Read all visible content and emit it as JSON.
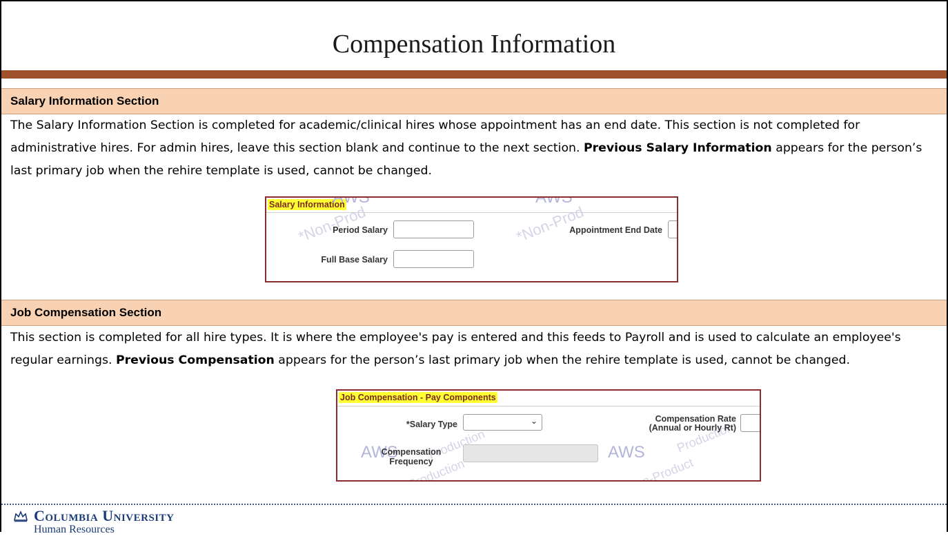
{
  "slide": {
    "title": "Compensation Information"
  },
  "salary_section": {
    "header": "Salary Information Section",
    "para_part1": "The Salary Information Section is completed for academic/clinical hires whose appointment has an end date. This section is not completed for administrative hires. For admin hires, leave this section blank and continue to the next section. ",
    "para_bold": "Previous Salary Information",
    "para_part2": " appears for the person’s last primary job when the rehire template is used, cannot be changed.",
    "panel": {
      "title": "Salary Information",
      "period_salary_label": "Period Salary",
      "appointment_end_date_label": "Appointment End Date",
      "full_base_salary_label": "Full Base Salary",
      "watermark_1": "*Non-Prod",
      "watermark_2": "*Non-Prod",
      "watermark_3": "AWS",
      "watermark_4": "AWS"
    }
  },
  "job_comp_section": {
    "header": "Job Compensation Section",
    "para_part1": "This section is completed for all hire types. It is where the employee's pay is entered and this feeds to Payroll and is used to calculate an employee's regular earnings. ",
    "para_bold": "Previous Compensation",
    "para_part2": " appears for the person’s last primary job when the rehire template is used, cannot be changed.",
    "panel": {
      "title": "Job Compensation - Pay Components",
      "salary_type_label": "*Salary Type",
      "salary_type_value": "",
      "compensation_rate_label_line1": "Compensation Rate",
      "compensation_rate_label_line2": "(Annual or Hourly Rt)",
      "compensation_frequency_label_line1": "Compensation",
      "compensation_frequency_label_line2": "Frequency",
      "watermark_aws_1": "AWS",
      "watermark_aws_2": "AWS",
      "watermark_prod_1": "Production",
      "watermark_prod_2": "Production",
      "watermark_prod_3": "n-Production",
      "watermark_prod_4": "n-Product"
    }
  },
  "footer": {
    "university": "Columbia University",
    "department": "Human Resources"
  },
  "colors": {
    "title_rule": "#a0522d",
    "section_header_bg": "#f9d2b4",
    "panel_border": "#8b2c2c",
    "highlight": "#ffff33",
    "logo_blue": "#1c3c78"
  }
}
